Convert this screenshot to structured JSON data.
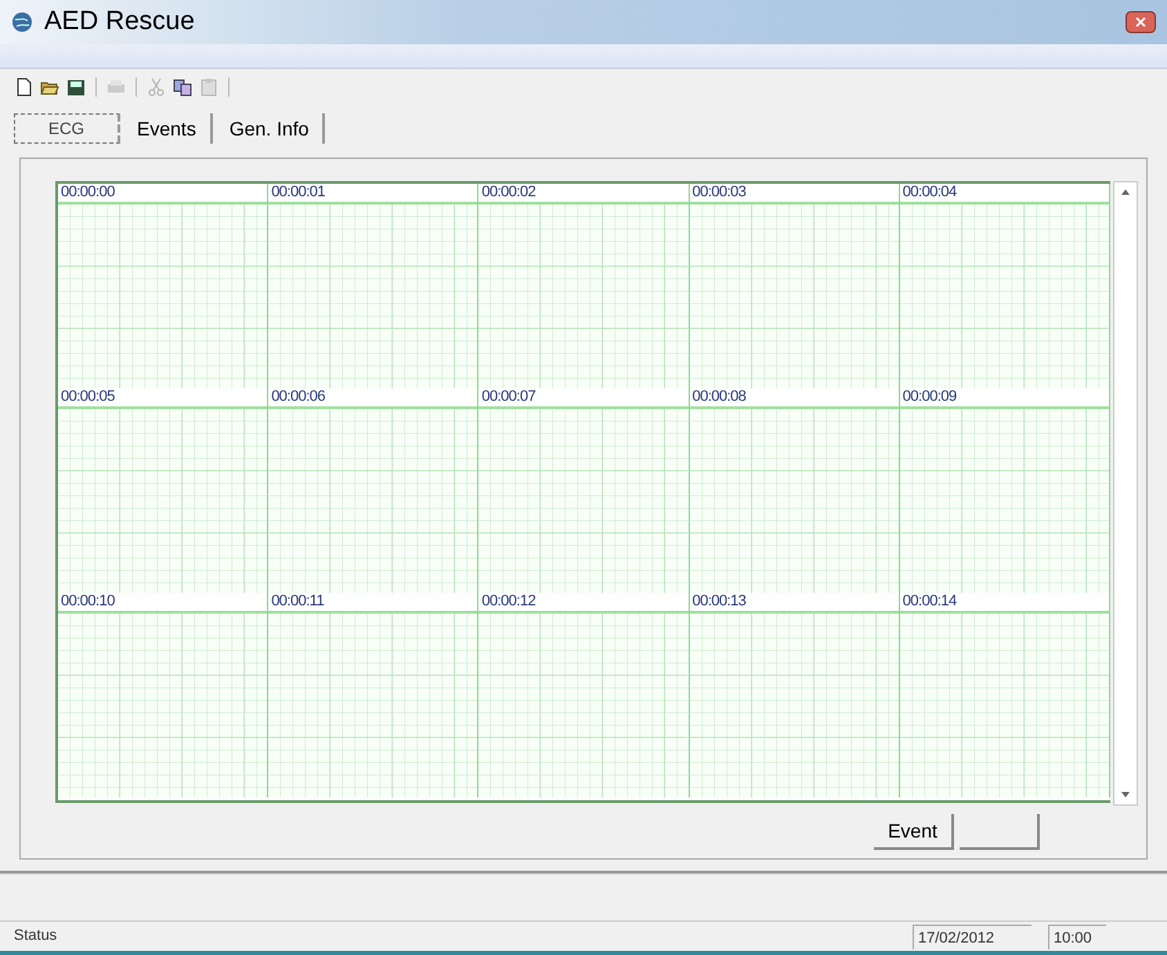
{
  "window": {
    "title": "AED Rescue"
  },
  "toolbar": [
    {
      "kind": "new",
      "disabled": false
    },
    {
      "kind": "open",
      "disabled": false
    },
    {
      "kind": "save",
      "disabled": false
    },
    {
      "kind": "separator"
    },
    {
      "kind": "print",
      "disabled": true
    },
    {
      "kind": "separator"
    },
    {
      "kind": "cut",
      "disabled": true
    },
    {
      "kind": "copy",
      "disabled": false
    },
    {
      "kind": "paste",
      "disabled": true
    },
    {
      "kind": "separator"
    }
  ],
  "tabs": [
    {
      "label": "ECG",
      "selected": true
    },
    {
      "label": "Events",
      "selected": false
    },
    {
      "label": "Gen. Info",
      "selected": false
    }
  ],
  "ecg": {
    "timestamps": [
      "00:00:00",
      "00:00:01",
      "00:00:02",
      "00:00:03",
      "00:00:04",
      "00:00:05",
      "00:00:06",
      "00:00:07",
      "00:00:08",
      "00:00:09",
      "00:00:10",
      "00:00:11",
      "00:00:12",
      "00:00:13",
      "00:00:14"
    ]
  },
  "buttons": [
    {
      "kind": "event",
      "label": "Event"
    },
    {
      "kind": "blank"
    }
  ],
  "status_bar": {
    "text": "Status",
    "date": "17/02/2012",
    "time": "10:00"
  }
}
